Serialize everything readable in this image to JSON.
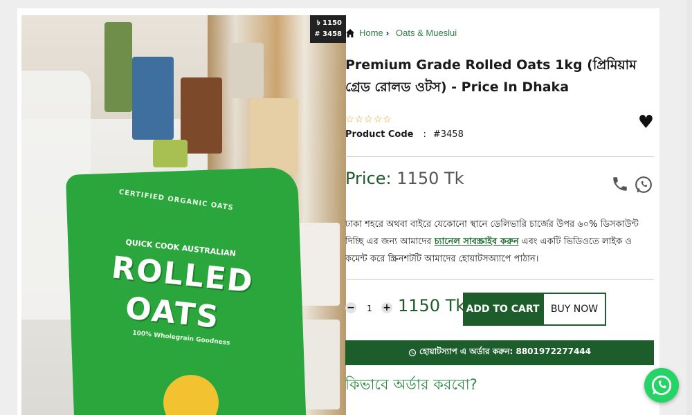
{
  "image": {
    "badge_price": "৳ 1150",
    "badge_code": "# 3458",
    "bag_line1": "CERTIFIED ORGANIC OATS",
    "bag_line2": "QUICK COOK AUSTRALIAN",
    "bag_word1": "ROLLED",
    "bag_word2": "OATS",
    "bag_line3": "100% Wholegrain Goodness"
  },
  "breadcrumb": {
    "home": "Home",
    "separator": "›",
    "category": "Oats & Mueslui"
  },
  "product": {
    "title": "Premium Grade Rolled Oats 1kg (প্রিমিয়াম গ্রেড রোলড ওটস) - Price In Dhaka",
    "rating_stars": 0,
    "rating_max": 5,
    "code_label": "Product Code",
    "code_colon": ":",
    "code_value": "#3458",
    "price_label": "Price:",
    "price_value": "1150 Tk"
  },
  "description": {
    "part1": "ঢাকা শহরে অথবা বাইরে যেকোনো স্থানে ডেলিভারি চার্জের উপর ৬০% ডিসকাউন্ট দিচ্ছি এর জন্য আমাদের ",
    "link": "চ্যানেল সাবস্ক্রাইব করুন",
    "part2": " এবং একটি ভিডিওতে লাইক ও কমেন্ট করে স্ক্রিনশটটি আমাদের হোয়াটসঅ্যাপে পাঠান।"
  },
  "cart": {
    "minus": "−",
    "quantity": "1",
    "plus": "+",
    "total": "1150 Tk",
    "add_to_cart": "ADD TO CART",
    "buy_now": "BUY NOW"
  },
  "whatsapp_order": {
    "label": "হোয়াটস্যাপ এ অর্ডার করুন: 8801972277444"
  },
  "how_to_order": "কিভাবে অর্ডার করবো?",
  "colors": {
    "brand_green": "#1d5d2c",
    "link_green": "#2e7d45",
    "star": "#e8a317",
    "whatsapp": "#25d366"
  },
  "icons": [
    "home-icon",
    "heart-icon",
    "phone-icon",
    "whatsapp-icon",
    "whatsapp-float-icon"
  ]
}
